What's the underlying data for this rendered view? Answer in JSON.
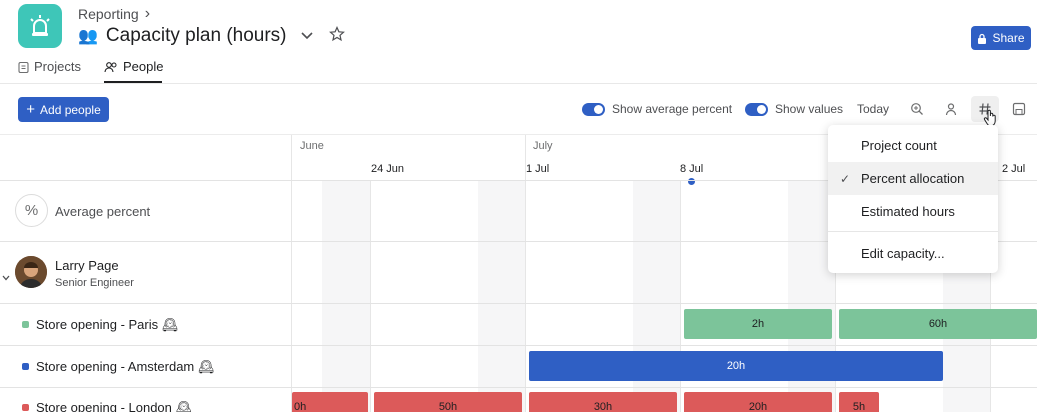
{
  "header": {
    "breadcrumb": "Reporting",
    "breadcrumb_chevron": "›",
    "title_emoji": "👥",
    "title": "Capacity plan (hours)",
    "share_label": "Share"
  },
  "tabs": [
    {
      "label": "Projects",
      "active": false
    },
    {
      "label": "People",
      "active": true
    }
  ],
  "toolbar": {
    "add_label": "Add people",
    "show_average_percent": "Show average percent",
    "show_values": "Show values",
    "today": "Today",
    "toggle_average_on": true,
    "toggle_values_on": true
  },
  "timeline": {
    "months": [
      "June",
      "July"
    ],
    "weeks": [
      "24 Jun",
      "1 Jul",
      "8 Jul",
      "2 Jul"
    ]
  },
  "average_row": {
    "label": "Average percent",
    "icon": "%"
  },
  "person": {
    "name": "Larry Page",
    "role": "Senior Engineer"
  },
  "projects": [
    {
      "label": "Store opening - Paris 🕰",
      "color": "#7cc49a",
      "bars": [
        "2h",
        "60h"
      ]
    },
    {
      "label": "Store opening - Amsterdam 🕰",
      "color": "#2f5fc4",
      "bars": [
        "20h"
      ]
    },
    {
      "label": "Store opening - London 🕰",
      "color": "#dc5a5a",
      "bars": [
        "0h",
        "50h",
        "30h",
        "20h",
        "5h"
      ]
    }
  ],
  "menu": {
    "items": [
      "Project count",
      "Percent allocation",
      "Estimated hours",
      "Edit capacity..."
    ],
    "selected": "Percent allocation",
    "check": "✓"
  },
  "colors": {
    "accent": "#2f5fc4",
    "app_icon": "#3ec6b8",
    "green": "#7cc49a",
    "blue": "#2f5fc4",
    "red": "#dc5a5a"
  }
}
